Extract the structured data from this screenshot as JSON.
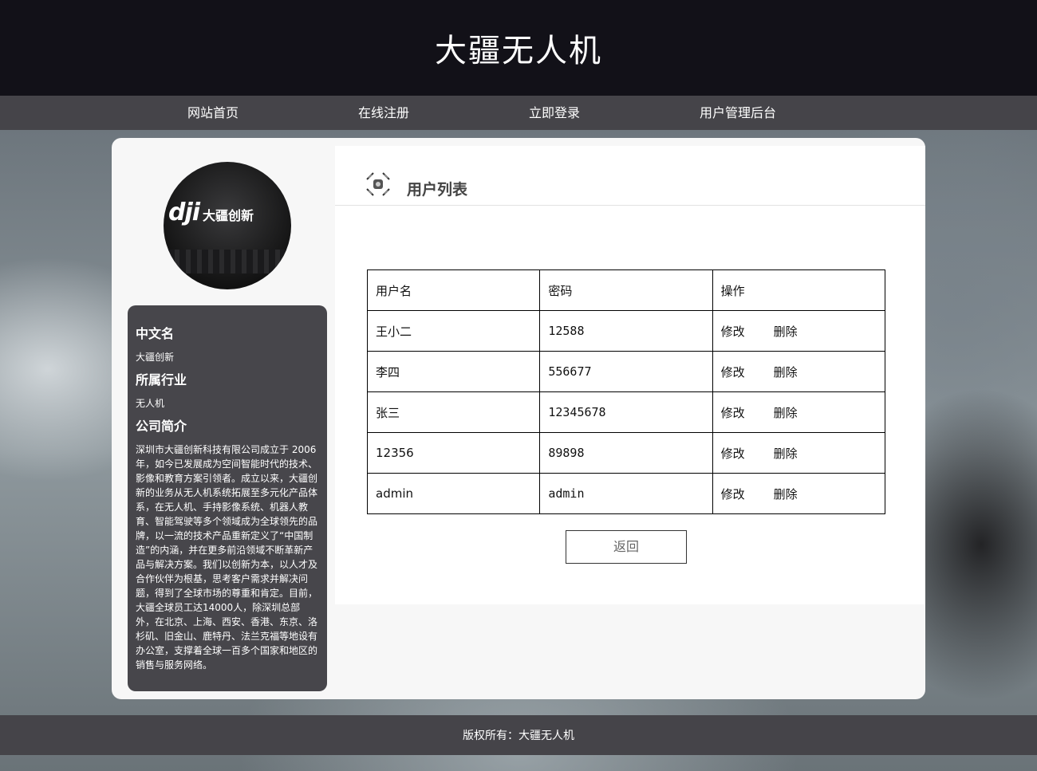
{
  "site": {
    "title": "大疆无人机"
  },
  "nav": {
    "items": [
      {
        "label": "网站首页"
      },
      {
        "label": "在线注册"
      },
      {
        "label": "立即登录"
      },
      {
        "label": "用户管理后台"
      }
    ]
  },
  "sidebar": {
    "avatar_text_latin": "dji",
    "avatar_text_cn": "大疆创新",
    "cn_name_heading": "中文名",
    "cn_name": "大疆创新",
    "industry_heading": "所属行业",
    "industry": "无人机",
    "intro_heading": "公司简介",
    "intro": "深圳市大疆创新科技有限公司成立于 2006年，如今已发展成为空间智能时代的技术、影像和教育方案引领者。成立以来，大疆创新的业务从无人机系统拓展至多元化产品体系，在无人机、手持影像系统、机器人教育、智能驾驶等多个领域成为全球领先的品牌，以一流的技术产品重新定义了“中国制造”的内涵，并在更多前沿领域不断革新产品与解决方案。我们以创新为本，以人才及合作伙伴为根基，思考客户需求并解决问题，得到了全球市场的尊重和肯定。目前，大疆全球员工达14000人，除深圳总部外，在北京、上海、西安、香港、东京、洛杉矶、旧金山、鹿特丹、法兰克福等地设有办公室，支撑着全球一百多个国家和地区的销售与服务网络。"
  },
  "main": {
    "title": "用户列表",
    "table": {
      "headers": [
        "用户名",
        "密码",
        "操作"
      ],
      "rows": [
        {
          "username": "王小二",
          "password": "12588"
        },
        {
          "username": "李四",
          "password": "556677"
        },
        {
          "username": "张三",
          "password": "12345678"
        },
        {
          "username": "12356",
          "password": "89898"
        },
        {
          "username": "admin",
          "password": "admin"
        }
      ],
      "edit_label": "修改",
      "delete_label": "删除"
    },
    "back_label": "返回"
  },
  "footer": {
    "text": "版权所有：大疆无人机"
  },
  "colors": {
    "header_bg": "#121118",
    "nav_bg": "#454449",
    "sidebar_info_bg": "#47464b",
    "card_bg": "#f7f7f7"
  },
  "icons": {
    "section_icon": "drone-icon"
  }
}
